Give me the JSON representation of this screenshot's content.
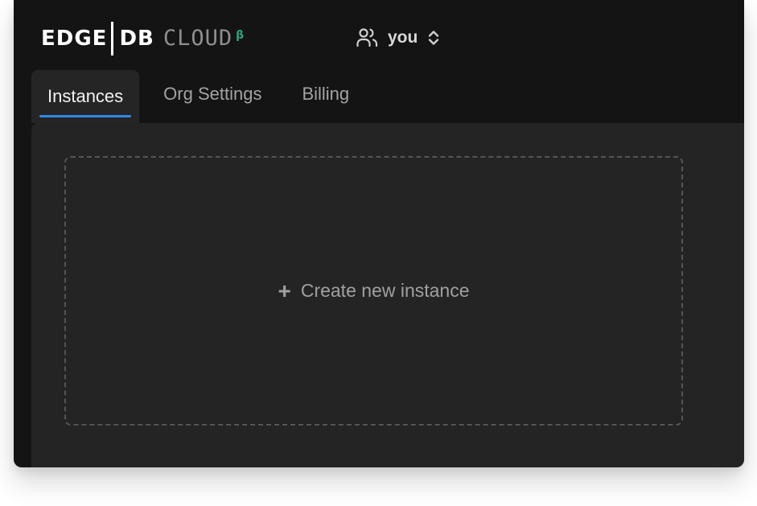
{
  "header": {
    "logo": {
      "part1": "EDGE",
      "part2": "DB",
      "part3": "CLOUD",
      "badge": "β"
    },
    "org_switcher": {
      "icon": "users-icon",
      "name": "you",
      "chevron_icon": "chevron-up-down-icon"
    }
  },
  "tabs": [
    {
      "label": "Instances",
      "active": true
    },
    {
      "label": "Org Settings",
      "active": false
    },
    {
      "label": "Billing",
      "active": false
    }
  ],
  "main": {
    "create_instance": {
      "icon": "plus-icon",
      "plus": "+",
      "label": "Create new instance"
    }
  },
  "colors": {
    "background": "#141414",
    "panel": "#242424",
    "accent": "#2e8ae6",
    "beta": "#2ea57a"
  }
}
